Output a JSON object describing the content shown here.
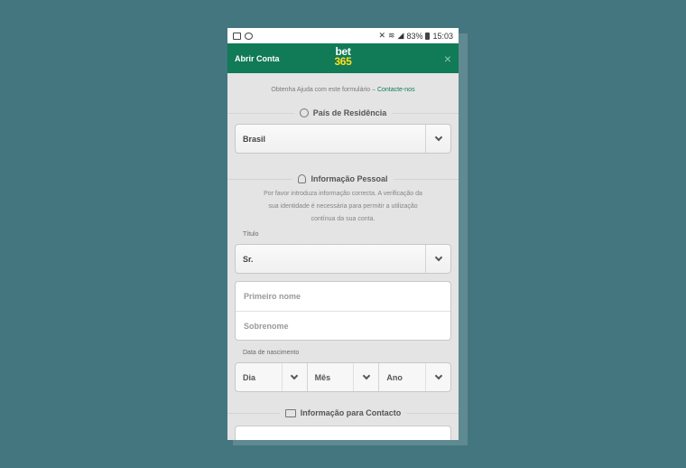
{
  "statusbar": {
    "battery_pct": "83%",
    "time": "15:03"
  },
  "header": {
    "title": "Abrir Conta",
    "logo_line1": "bet",
    "logo_line2": "365",
    "close": "×"
  },
  "help": {
    "text": "Obtenha Ajuda com este formulário – ",
    "link": "Contacte-nos"
  },
  "country_section": {
    "heading": "País de Residência",
    "selected": "Brasil"
  },
  "personal_section": {
    "heading": "Informação Pessoal",
    "line1": "Por favor introduza informação correcta. A verificação da",
    "line2": "sua identidade é necessária para permitir a utilização",
    "line3": "contínua da sua conta.",
    "title_label": "Título",
    "title_value": "Sr.",
    "first_name_placeholder": "Primeiro nome",
    "last_name_placeholder": "Sobrenome",
    "dob_label": "Data de nascimento",
    "day": "Dia",
    "month": "Mês",
    "year": "Ano"
  },
  "contact_section": {
    "heading": "Informação para Contacto"
  },
  "colors": {
    "brand_green": "#117a56",
    "logo_yellow": "#ffdf1b",
    "background": "#447680"
  }
}
